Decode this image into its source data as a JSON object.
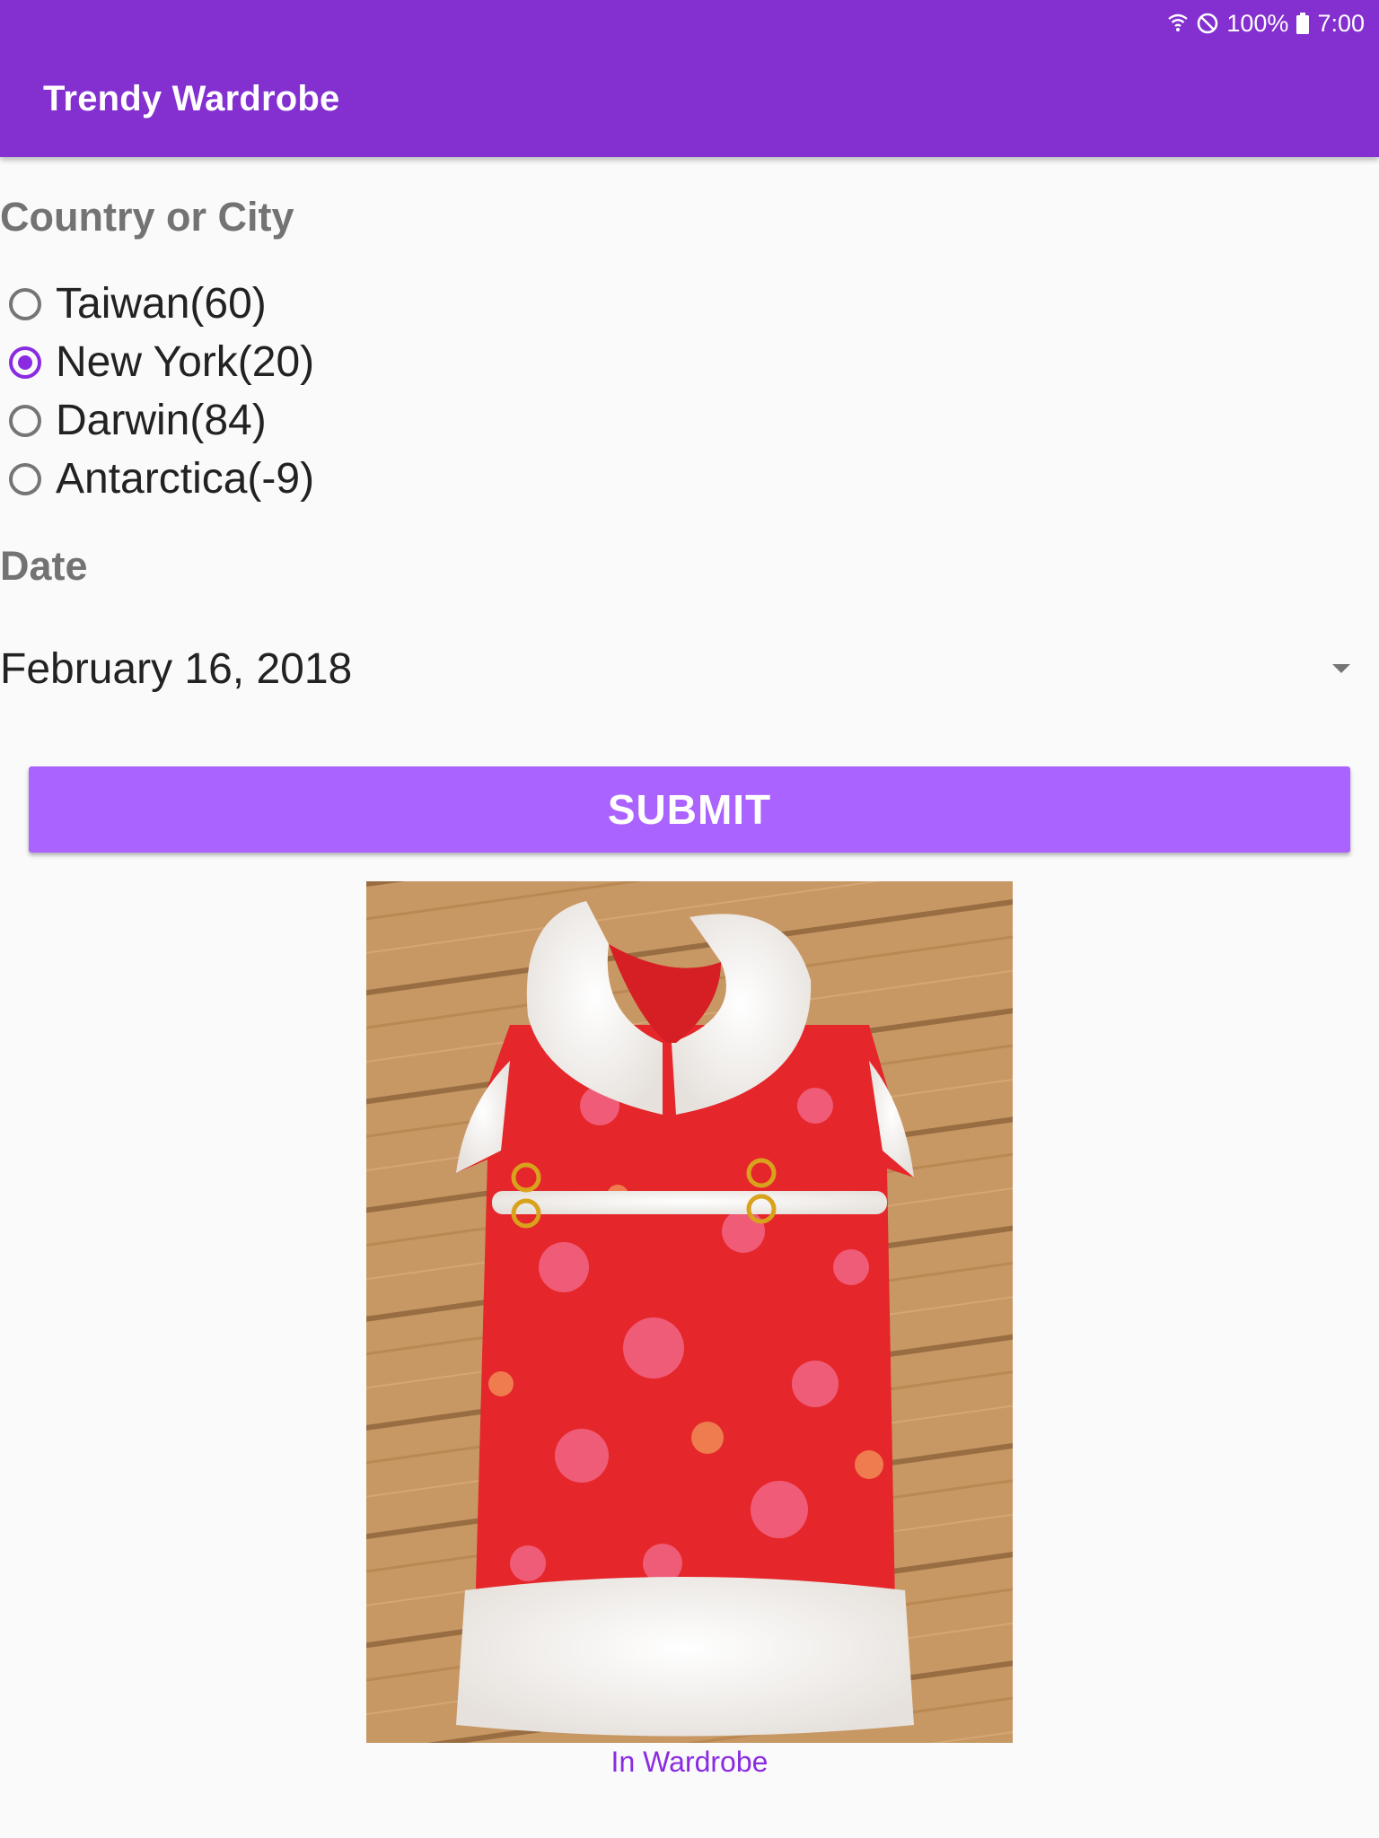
{
  "status_bar": {
    "battery": "100%",
    "time": "7:00",
    "icons": [
      "wifi-icon",
      "do-not-disturb-icon",
      "battery-icon"
    ]
  },
  "app": {
    "title": "Trendy Wardrobe"
  },
  "location": {
    "label": "Country or City",
    "options": [
      {
        "label": "Taiwan(60)",
        "checked": false
      },
      {
        "label": "New York(20)",
        "checked": true
      },
      {
        "label": "Darwin(84)",
        "checked": false
      },
      {
        "label": "Antarctica(-9)",
        "checked": false
      }
    ]
  },
  "date": {
    "label": "Date",
    "value": "February 16, 2018"
  },
  "submit": {
    "label": "SUBMIT"
  },
  "result": {
    "image": "red-dress-with-white-fur-trim",
    "caption": "In Wardrobe"
  },
  "colors": {
    "app_bar": "#842fcf",
    "button": "#ab63ff",
    "accent": "#8a2be2"
  }
}
